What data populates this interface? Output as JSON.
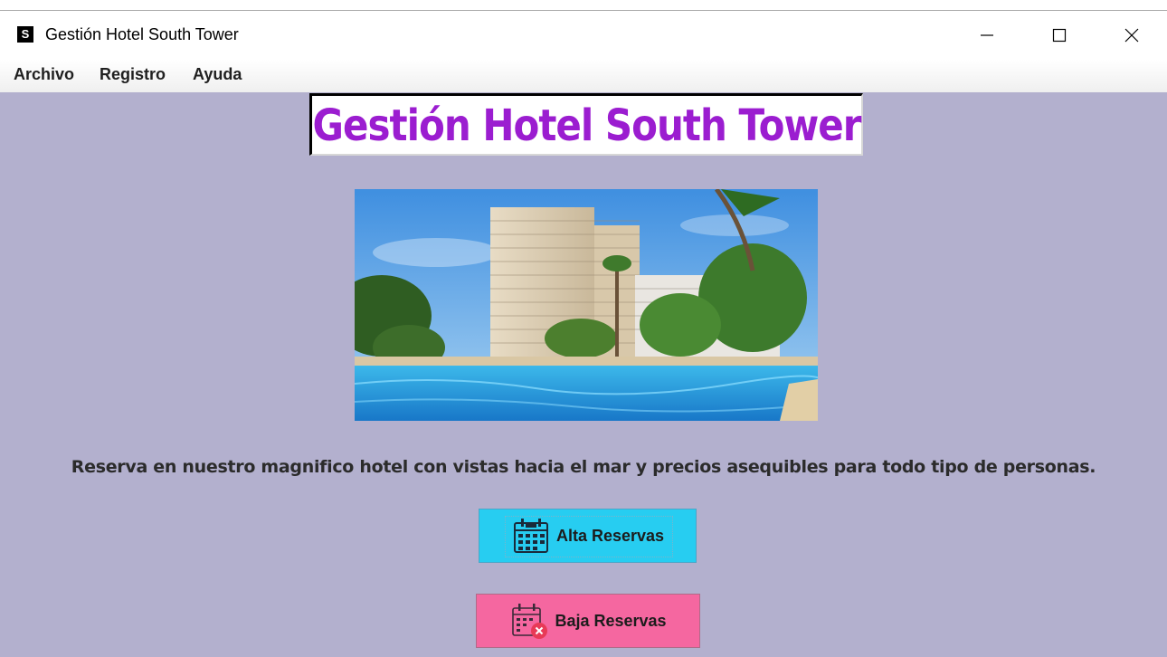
{
  "window": {
    "app_icon_letter": "S",
    "title": "Gestión Hotel South Tower",
    "controls": [
      "minimize-icon",
      "maximize-icon",
      "close-icon"
    ]
  },
  "menu": {
    "items": [
      {
        "label": "Archivo"
      },
      {
        "label": "Registro"
      },
      {
        "label": "Ayuda"
      }
    ]
  },
  "main": {
    "heading": "Gestión Hotel South Tower",
    "image": {
      "description_icon": "hotel-photo"
    },
    "description": "Reserva en nuestro magnifico hotel con vistas hacia el mar y precios asequibles para todo tipo de personas.",
    "buttons": [
      {
        "label": "Alta Reservas",
        "icon": "calendar-icon",
        "color": "#27cdf1"
      },
      {
        "label": "Baja Reservas",
        "icon": "calendar-remove-icon",
        "color": "#f567a0"
      }
    ]
  },
  "colors": {
    "background": "#b3b0ce",
    "heading": "#9b1dd0"
  }
}
